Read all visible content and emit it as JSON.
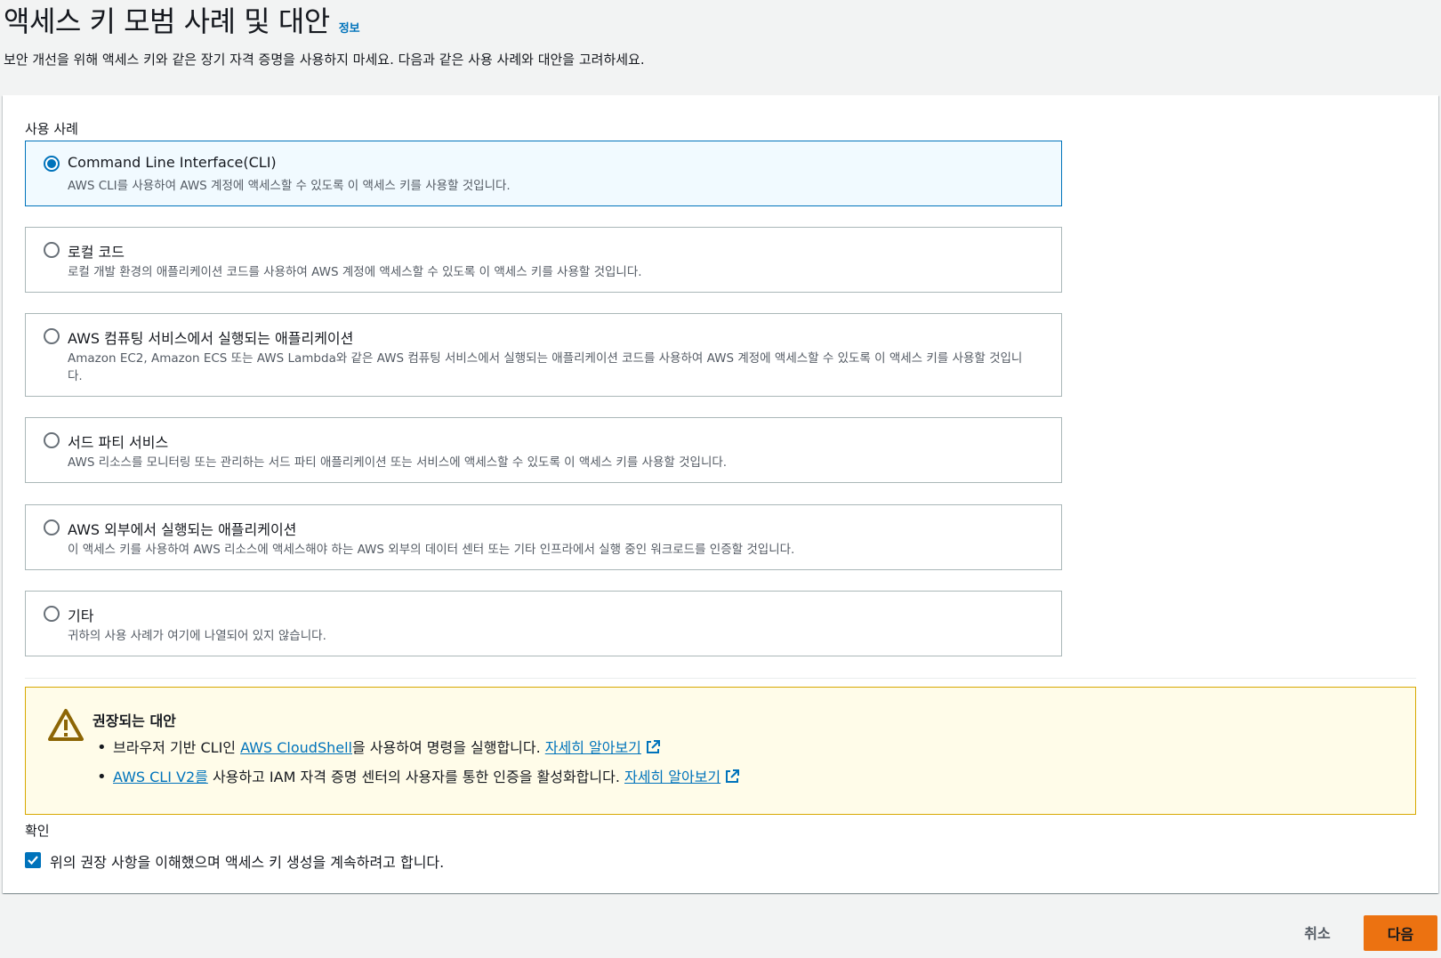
{
  "header": {
    "title": "액세스 키 모범 사례 및 대안",
    "info_link": "정보",
    "description": "보안 개선을 위해 액세스 키와 같은 장기 자격 증명을 사용하지 마세요. 다음과 같은 사용 사례와 대안을 고려하세요."
  },
  "use_cases": {
    "label": "사용 사례",
    "selected": 0,
    "options": [
      {
        "title": "Command Line Interface(CLI)",
        "desc": "AWS CLI를 사용하여 AWS 계정에 액세스할 수 있도록 이 액세스 키를 사용할 것입니다."
      },
      {
        "title": "로컬 코드",
        "desc": "로컬 개발 환경의 애플리케이션 코드를 사용하여 AWS 계정에 액세스할 수 있도록 이 액세스 키를 사용할 것입니다."
      },
      {
        "title": "AWS 컴퓨팅 서비스에서 실행되는 애플리케이션",
        "desc": "Amazon EC2, Amazon ECS 또는 AWS Lambda와 같은 AWS 컴퓨팅 서비스에서 실행되는 애플리케이션 코드를 사용하여 AWS 계정에 액세스할 수 있도록 이 액세스 키를 사용할 것입니다."
      },
      {
        "title": "서드 파티 서비스",
        "desc": "AWS 리소스를 모니터링 또는 관리하는 서드 파티 애플리케이션 또는 서비스에 액세스할 수 있도록 이 액세스 키를 사용할 것입니다."
      },
      {
        "title": "AWS 외부에서 실행되는 애플리케이션",
        "desc": "이 액세스 키를 사용하여 AWS 리소스에 액세스해야 하는 AWS 외부의 데이터 센터 또는 기타 인프라에서 실행 중인 워크로드를 인증할 것입니다."
      },
      {
        "title": "기타",
        "desc": "귀하의 사용 사례가 여기에 나열되어 있지 않습니다."
      }
    ]
  },
  "alert": {
    "title": "권장되는 대안",
    "item1": {
      "prefix": "브라우저 기반 CLI인 ",
      "link": "AWS CloudShell",
      "suffix": "을 사용하여 명령을 실행합니다. ",
      "learn_more": "자세히 알아보기"
    },
    "item2": {
      "link": "AWS CLI V2를",
      "suffix": " 사용하고 IAM 자격 증명 센터의 사용자를 통한 인증을 활성화합니다. ",
      "learn_more": "자세히 알아보기"
    }
  },
  "confirmation": {
    "label": "확인",
    "checked": true,
    "checkbox_label": "위의 권장 사항을 이해했으며 액세스 키 생성을 계속하려고 합니다."
  },
  "footer": {
    "cancel": "취소",
    "next": "다음"
  },
  "colors": {
    "accent": "#0073bb",
    "primary_button": "#ec7211",
    "warning_bg": "#fffce9",
    "warning_border": "#d7a800",
    "warning_icon": "#8d6605"
  }
}
